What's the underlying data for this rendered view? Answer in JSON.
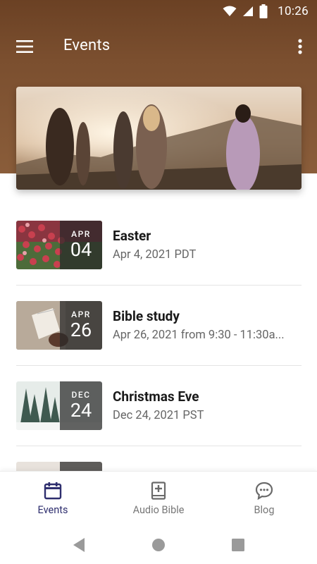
{
  "status_bar": {
    "time": "10:26"
  },
  "app_bar": {
    "title": "Events"
  },
  "events": [
    {
      "title": "Easter",
      "subtitle": "Apr 4, 2021 PDT",
      "month": "APR",
      "day": "04"
    },
    {
      "title": "Bible study",
      "subtitle": "Apr 26, 2021 from 9:30 - 11:30a...",
      "month": "APR",
      "day": "26"
    },
    {
      "title": "Christmas Eve",
      "subtitle": "Dec 24, 2021 PST",
      "month": "DEC",
      "day": "24"
    }
  ],
  "bottom_nav": {
    "items": [
      {
        "label": "Events",
        "icon": "calendar-icon",
        "active": true
      },
      {
        "label": "Audio Bible",
        "icon": "bible-plus-icon",
        "active": false
      },
      {
        "label": "Blog",
        "icon": "chat-bubble-icon",
        "active": false
      }
    ]
  },
  "colors": {
    "header": "#7b4f2f",
    "accent": "#2e2e6e"
  }
}
